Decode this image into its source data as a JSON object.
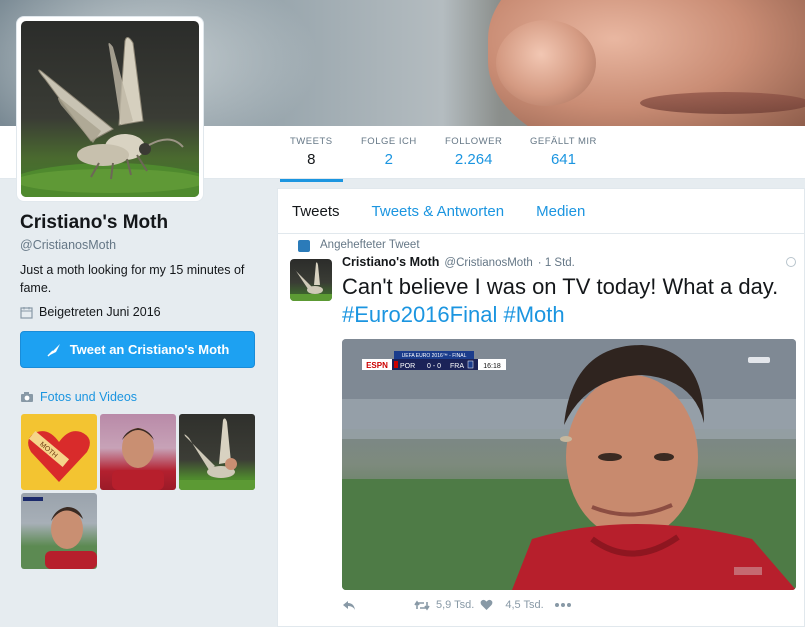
{
  "colors": {
    "accent": "#1da1f2",
    "link": "#1b95e0",
    "text": "#14171a",
    "muted": "#657786"
  },
  "profile": {
    "name": "Cristiano's Moth",
    "handle": "@CristianosMoth",
    "bio": "Just a moth looking for my 15 minutes of fame.",
    "joined": "Beigetreten Juni 2016",
    "tweet_to_label": "Tweet an Cristiano's Moth"
  },
  "stats": [
    {
      "label": "TWEETS",
      "value": "8"
    },
    {
      "label": "FOLGE ICH",
      "value": "2"
    },
    {
      "label": "FOLLOWER",
      "value": "2.264"
    },
    {
      "label": "GEFÄLLT MIR",
      "value": "641"
    }
  ],
  "media": {
    "title": "Fotos und Videos",
    "thumb_text": "MOTH"
  },
  "tabs": [
    "Tweets",
    "Tweets & Antworten",
    "Medien"
  ],
  "tweet": {
    "pinned_label": "Angehefteter Tweet",
    "name": "Cristiano's Moth",
    "handle": "@CristianosMoth",
    "time": "· 1 Std.",
    "text_plain": "Can't believe I was on TV today! What a day.",
    "hashtag1": "#Euro2016Final",
    "hashtag2": "#Moth",
    "retweets": "5,9 Tsd.",
    "likes": "4,5 Tsd."
  },
  "scorebug": {
    "network": "ESPN",
    "event": "UEFA EURO 2016™ - FINAL",
    "team1": "POR",
    "score": "0 - 0",
    "team2": "FRA",
    "clock": "16:18"
  },
  "icons": [
    "calendar-icon",
    "camera-icon",
    "quill-icon",
    "pin-icon",
    "reply-icon",
    "retweet-icon",
    "heart-icon",
    "more-icon",
    "caret-icon"
  ]
}
